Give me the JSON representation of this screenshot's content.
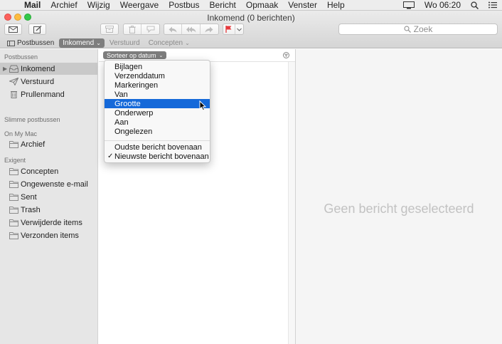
{
  "menubar": {
    "apple": "",
    "app_name": "Mail",
    "items": [
      "Archief",
      "Wijzig",
      "Weergave",
      "Postbus",
      "Bericht",
      "Opmaak",
      "Venster",
      "Help"
    ],
    "clock": "Wo 06:20",
    "status_icons": [
      "display-mirroring-icon",
      "search-icon",
      "notification-list-icon"
    ]
  },
  "window": {
    "title": "Inkomend (0 berichten)"
  },
  "toolbar": {
    "buttons": [
      "get-mail-icon",
      "compose-icon",
      "archive-icon",
      "delete-icon",
      "junk-icon",
      "reply-icon",
      "reply-all-icon",
      "forward-icon",
      "flag-icon"
    ],
    "flag_color": "#e5383b",
    "search_placeholder": "Zoek"
  },
  "favorites": {
    "items": [
      {
        "label": "Postbussen",
        "state": "normal"
      },
      {
        "label": "Inkomend",
        "state": "selected",
        "chevron": "⌄"
      },
      {
        "label": "Verstuurd",
        "state": "dimmed"
      },
      {
        "label": "Concepten",
        "state": "dimmed",
        "chevron": "⌄"
      }
    ]
  },
  "sidebar": {
    "sections": {
      "mailboxes": "Postbussen",
      "smart": "Slimme postbussen",
      "onmymac": "On My Mac",
      "exigent": "Exigent"
    },
    "items": {
      "inbox": "Inkomend",
      "sent": "Verstuurd",
      "trash": "Prullenmand",
      "archive": "Archief",
      "drafts": "Concepten",
      "junk": "Ongewenste e-mail",
      "sent2": "Sent",
      "trash2": "Trash",
      "deleted": "Verwijderde items",
      "sent_items": "Verzonden items"
    }
  },
  "message_list": {
    "sort_label": "Sorteer op datum",
    "sort_chevron": "⌄"
  },
  "sort_menu": {
    "items": [
      "Bijlagen",
      "Verzenddatum",
      "Markeringen",
      "Van",
      "Grootte",
      "Onderwerp",
      "Aan",
      "Ongelezen"
    ],
    "highlighted": "Grootte",
    "order_items": [
      "Oudste bericht bovenaan",
      "Nieuwste bericht bovenaan"
    ],
    "checked": "Nieuwste bericht bovenaan",
    "check_mark": "✓"
  },
  "preview": {
    "empty_text": "Geen bericht geselecteerd"
  },
  "colors": {
    "highlight": "#1569d9",
    "sidebar_bg": "#e6e6e6",
    "folder_icon": "#8b8b8b"
  }
}
